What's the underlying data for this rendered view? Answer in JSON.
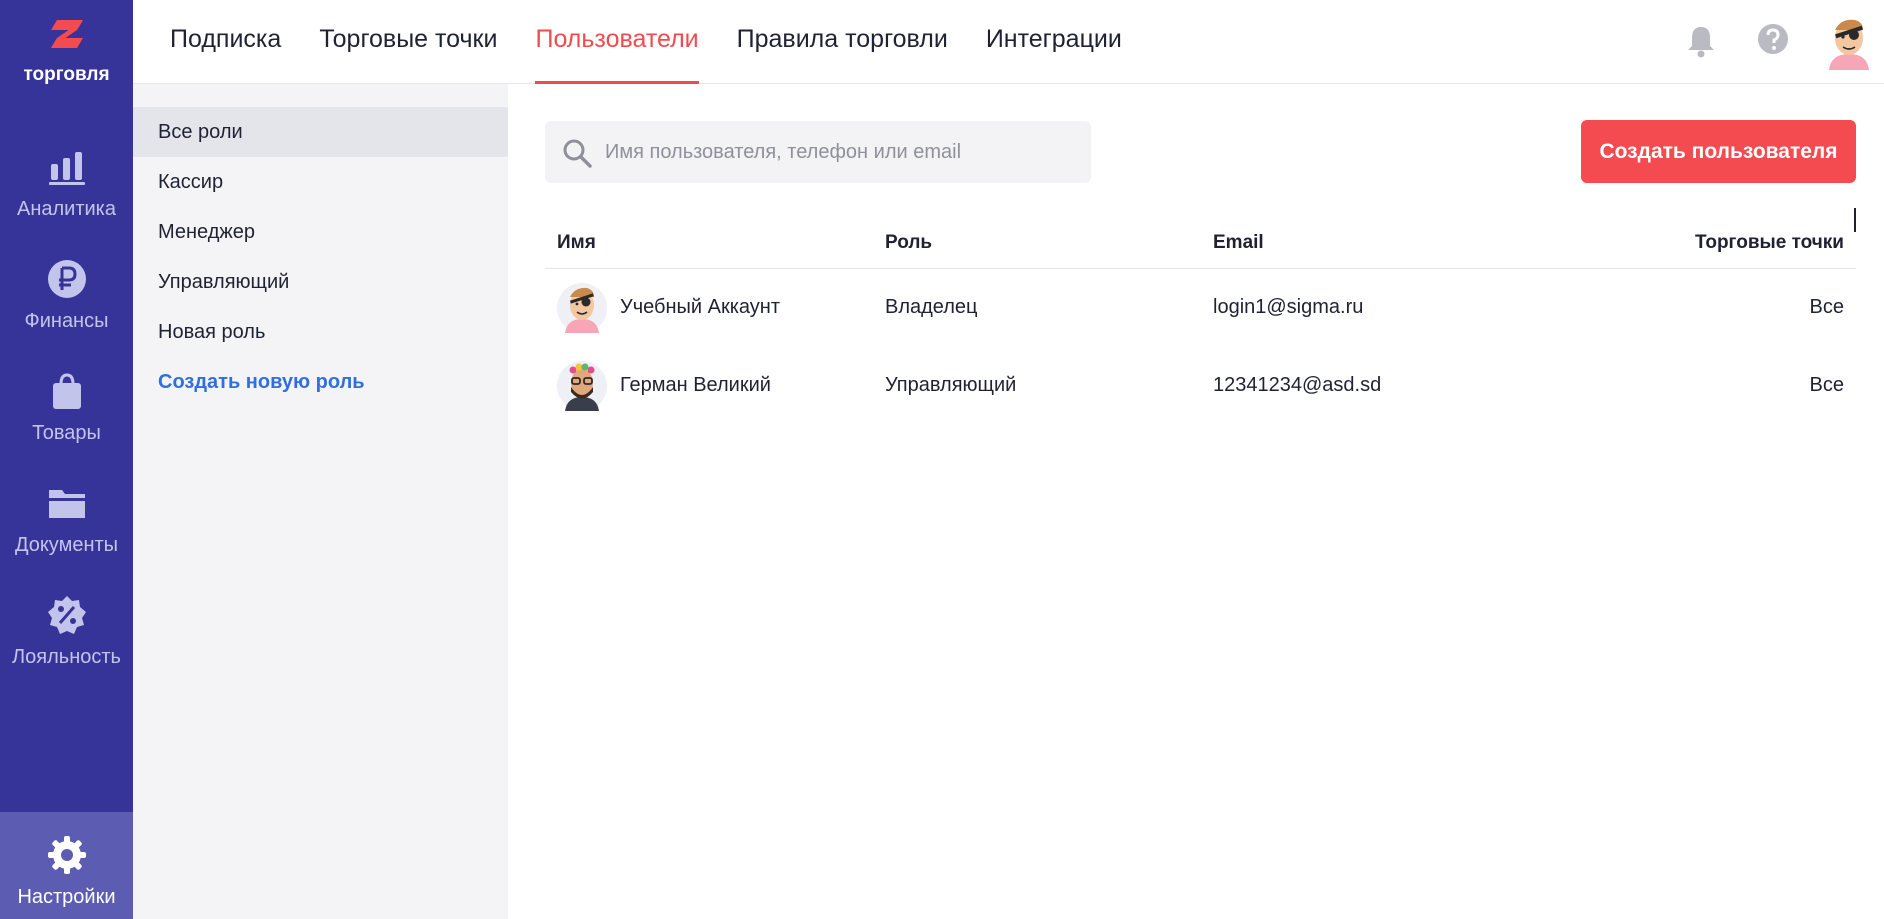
{
  "brand": {
    "name": "торговля",
    "logo_color": "#f34b4f"
  },
  "rail": {
    "items": [
      {
        "label": "Аналитика",
        "icon": "bar-chart-icon"
      },
      {
        "label": "Финансы",
        "icon": "ruble-icon"
      },
      {
        "label": "Товары",
        "icon": "shopping-bag-icon"
      },
      {
        "label": "Документы",
        "icon": "folder-icon"
      },
      {
        "label": "Лояльность",
        "icon": "discount-badge-icon"
      }
    ],
    "settings": {
      "label": "Настройки",
      "icon": "gear-icon",
      "active": true
    }
  },
  "tabs": [
    {
      "label": "Подписка"
    },
    {
      "label": "Торговые точки"
    },
    {
      "label": "Пользователи",
      "active": true
    },
    {
      "label": "Правила торговли"
    },
    {
      "label": "Интеграции"
    }
  ],
  "top_icons": [
    "bell-icon",
    "help-icon",
    "user-avatar"
  ],
  "roles": {
    "items": [
      {
        "label": "Все роли",
        "active": true
      },
      {
        "label": "Кассир"
      },
      {
        "label": "Менеджер"
      },
      {
        "label": "Управляющий"
      },
      {
        "label": "Новая роль"
      }
    ],
    "create_label": "Создать новую роль"
  },
  "search": {
    "placeholder": "Имя пользователя, телефон или email",
    "value": ""
  },
  "create_user_label": "Создать пользователя",
  "table": {
    "headers": {
      "name": "Имя",
      "role": "Роль",
      "email": "Email",
      "shops": "Торговые точки"
    },
    "rows": [
      {
        "name": "Учебный Аккаунт",
        "role": "Владелец",
        "email": "login1@sigma.ru",
        "shops": "Все"
      },
      {
        "name": "Герман Великий",
        "role": "Управляющий",
        "email": "12341234@asd.sd",
        "shops": "Все"
      }
    ]
  },
  "colors": {
    "rail": "#363498",
    "accent": "#f34b4f",
    "link": "#2f6fe0"
  }
}
